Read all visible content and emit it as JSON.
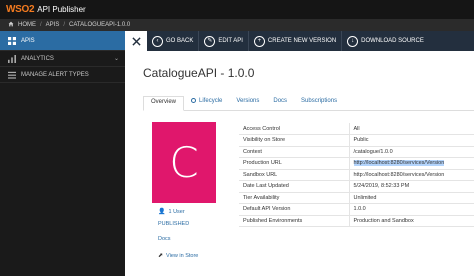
{
  "header": {
    "logo_mark": "WSO2",
    "app_title": "API Publisher"
  },
  "breadcrumb": {
    "home": "HOME",
    "apis": "APIS",
    "current": "CATALOGUEAPI-1.0.0"
  },
  "sidebar": {
    "items": [
      {
        "label": "APIS",
        "icon": "apis-icon"
      },
      {
        "label": "ANALYTICS",
        "icon": "analytics-icon"
      },
      {
        "label": "MANAGE ALERT TYPES",
        "icon": "alert-icon"
      }
    ]
  },
  "actions": {
    "go_back": "GO BACK",
    "edit_api": "EDIT API",
    "create_version": "CREATE NEW VERSION",
    "download_source": "DOWNLOAD SOURCE"
  },
  "main": {
    "title": "CatalogueAPI - 1.0.0",
    "tabs": [
      {
        "label": "Overview"
      },
      {
        "label": "Lifecycle"
      },
      {
        "label": "Versions"
      },
      {
        "label": "Docs"
      },
      {
        "label": "Subscriptions"
      }
    ],
    "thumbnail_letter": "C",
    "thumbnail_color": "#e0176c",
    "meta": {
      "users": "1 User",
      "status": "PUBLISHED",
      "docs": "Docs",
      "view_store": "View in Store"
    },
    "properties": [
      {
        "key": "Access Control",
        "value": "All"
      },
      {
        "key": "Visibility on Store",
        "value": "Public"
      },
      {
        "key": "Context",
        "value": "/catalogue/1.0.0"
      },
      {
        "key": "Production URL",
        "value": "http://localhost:8280/services/Version"
      },
      {
        "key": "Sandbox URL",
        "value": "http://localhost:8280/services/Version"
      },
      {
        "key": "Date Last Updated",
        "value": "5/24/2019, 8:52:33 PM"
      },
      {
        "key": "Tier Availability",
        "value": "Unlimited"
      },
      {
        "key": "Default API Version",
        "value": "1.0.0"
      },
      {
        "key": "Published Environments",
        "value": "Production and Sandbox"
      }
    ]
  },
  "colors": {
    "accent": "#2b6ca3",
    "actionbar": "#232f3e",
    "header": "#151515",
    "sidebar": "#1a1a1a"
  }
}
